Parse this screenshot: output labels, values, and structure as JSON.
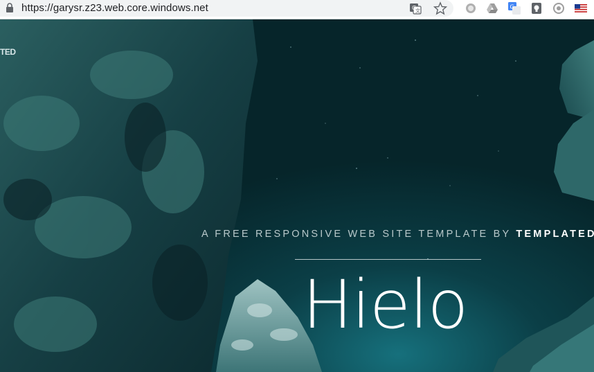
{
  "browser": {
    "url": "https://garysr.z23.web.core.windows.net",
    "icons": [
      "lock-icon",
      "translate-icon",
      "star-icon",
      "extension-circle-icon",
      "drive-icon",
      "google-translate-icon",
      "keep-icon",
      "eye-extension-icon",
      "us-flag-icon"
    ]
  },
  "hero": {
    "brand_fragment": "TED",
    "tagline_prefix": "A FREE RESPONSIVE WEB SITE TEMPLATE BY",
    "tagline_brand": "TEMPLATED",
    "title": "Hielo"
  },
  "colors": {
    "sky_dark": "#06262b",
    "sky_glow": "#0f5a66",
    "rock": "#1d4f52",
    "text": "#ffffff"
  }
}
